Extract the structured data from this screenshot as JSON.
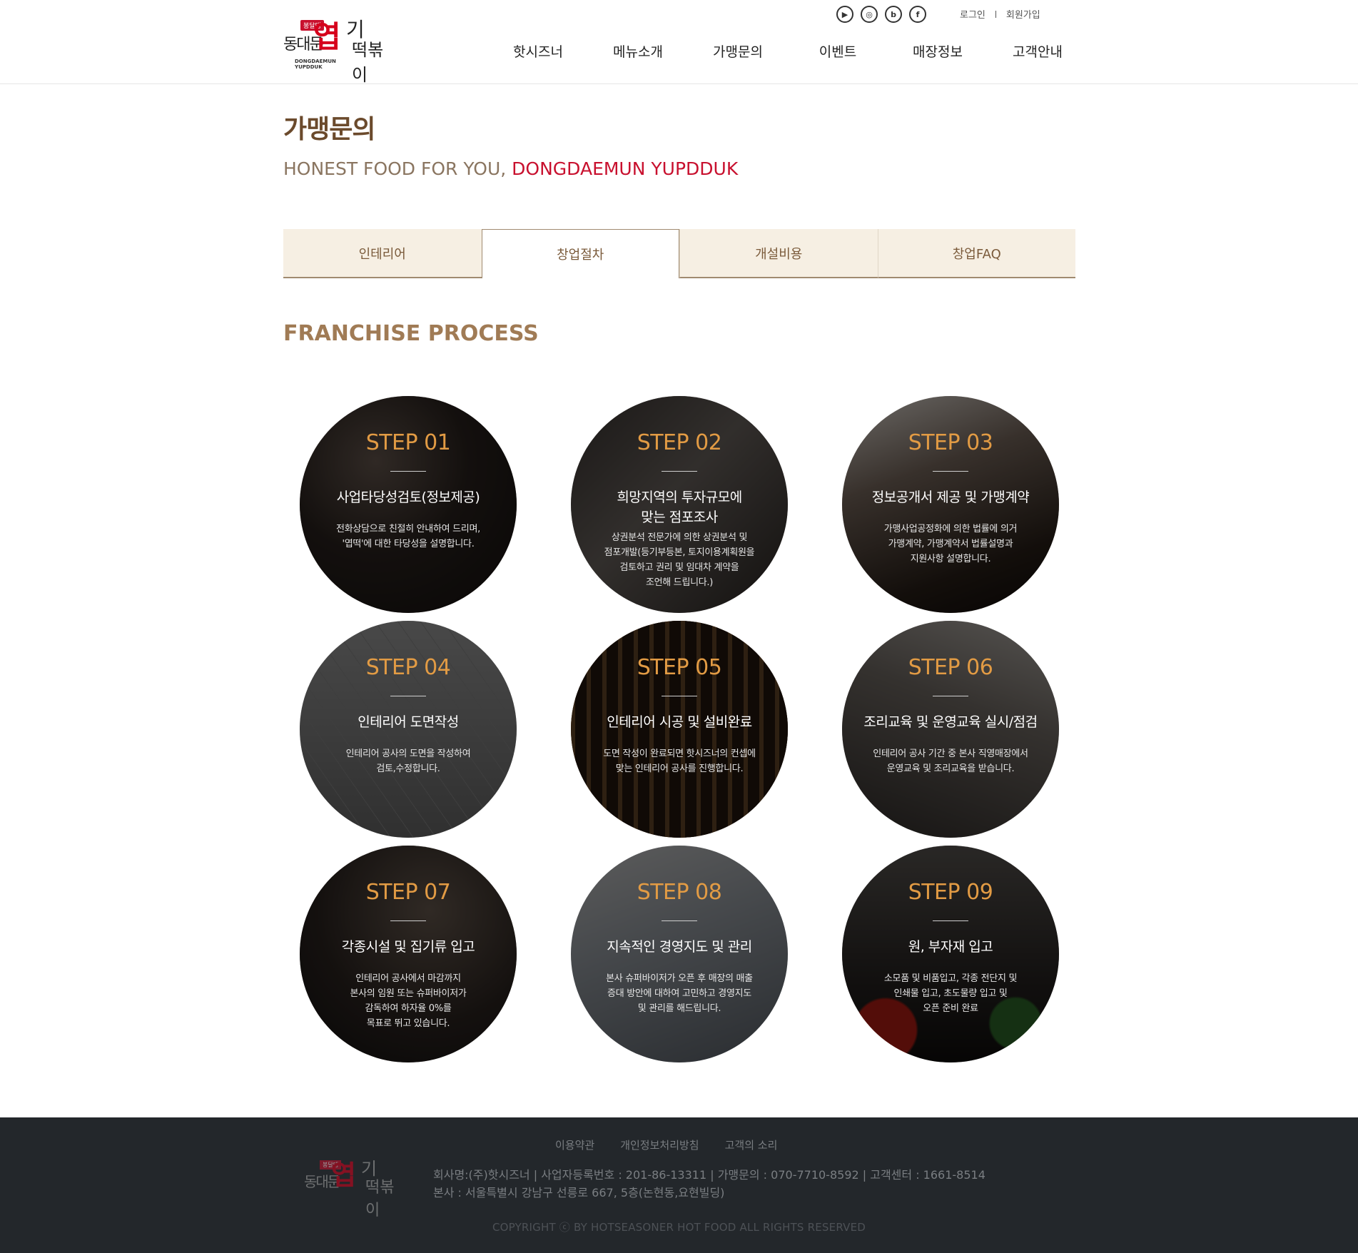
{
  "header": {
    "logo": {
      "badge": "봉달댕",
      "dong": "동대문",
      "yeop": "엽",
      "ki": "기",
      "bok": "떡볶이",
      "eng": "DONGDAEMUN YUPDDUK"
    },
    "sns_icons": [
      "youtube-icon",
      "instagram-icon",
      "blog-icon",
      "facebook-icon"
    ],
    "sns_glyphs": [
      "▶",
      "◎",
      "b",
      "f"
    ],
    "util": {
      "login": "로그인",
      "join": "회원가입"
    },
    "nav": [
      "핫시즈너",
      "메뉴소개",
      "가맹문의",
      "이벤트",
      "매장정보",
      "고객안내"
    ]
  },
  "page": {
    "title": "가맹문의",
    "subtitle_prefix": "HONEST FOOD FOR YOU,",
    "subtitle_brand": "DONGDAEMUN YUPDDUK"
  },
  "tabs": [
    {
      "label": "인테리어",
      "active": false
    },
    {
      "label": "창업절차",
      "active": true
    },
    {
      "label": "개설비용",
      "active": false
    },
    {
      "label": "창업FAQ",
      "active": false
    }
  ],
  "section_title": "FRANCHISE PROCESS",
  "steps": [
    {
      "num": "STEP 01",
      "title": [
        "사업타당성검토(정보제공)"
      ],
      "text": [
        "전화상담으로 친절히 안내하여 드리며,",
        "'엽떡'에 대한 타당성을 설명합니다."
      ]
    },
    {
      "num": "STEP 02",
      "title": [
        "희망지역의 투자규모에",
        "맞는 점포조사"
      ],
      "text": [
        "상권분석 전문가에 의한 상권분석 및",
        "점포개발(등기부등본, 토지이용계획원을",
        "검토하고 권리 및 임대차 계약을",
        "조언해 드립니다.)"
      ]
    },
    {
      "num": "STEP 03",
      "title": [
        "정보공개서 제공 및 가맹계약"
      ],
      "text": [
        "가맹사업공정화에 의한 법률에 의거",
        "가맹계약, 가맹계약서 법률설명과",
        "지원사항 설명합니다."
      ]
    },
    {
      "num": "STEP 04",
      "title": [
        "인테리어 도면작성"
      ],
      "text": [
        "인테리어 공사의 도면을 작성하여",
        "검토,수정합니다."
      ]
    },
    {
      "num": "STEP 05",
      "title": [
        "인테리어 시공 및 설비완료"
      ],
      "text": [
        "도면 작성이 완료되면 핫시즈너의 컨셉에",
        "맞는 인테리어 공사를 진행합니다."
      ]
    },
    {
      "num": "STEP 06",
      "title": [
        "조리교육 및 운영교육 실시/점검"
      ],
      "text": [
        "인테리어 공사 기간 중 본사 직영매장에서",
        "운영교육 및 조리교육을 받습니다."
      ]
    },
    {
      "num": "STEP 07",
      "title": [
        "각종시설 및 집기류 입고"
      ],
      "text": [
        "인테리어 공사에서 마감까지",
        "본사의 임원 또는 슈퍼바이저가",
        "감독하여 하자율 0%를",
        "목표로 뛰고 있습니다."
      ]
    },
    {
      "num": "STEP 08",
      "title": [
        "지속적인 경영지도 및 관리"
      ],
      "text": [
        "본사 슈퍼바이저가 오픈 후 매장의 매출",
        "증대 방안에 대하여 고민하고 경영지도",
        "및 관리를 해드립니다."
      ]
    },
    {
      "num": "STEP 09",
      "title": [
        "원, 부자재 입고"
      ],
      "text": [
        "소모품 및 비품입고, 각종 전단지 및",
        "인쇄물 입고, 초도물량 입고 및",
        "오픈 준비 완료"
      ]
    }
  ],
  "footer": {
    "links": [
      "이용약관",
      "개인정보처리방침",
      "고객의 소리"
    ],
    "info_line1": "회사명:(주)핫시즈너  |  사업자등록번호 : 201-86-13311  |  가맹문의 : 070-7710-8592  |  고객센터 : 1661-8514",
    "info_line2": "본사 : 서울특별시 강남구 선릉로 667, 5층(논현동,요현빌딩)",
    "copyright": "COPYRIGHT ⓒ BY HOTSEASONER HOT FOOD ALL RIGHTS RESERVED"
  }
}
